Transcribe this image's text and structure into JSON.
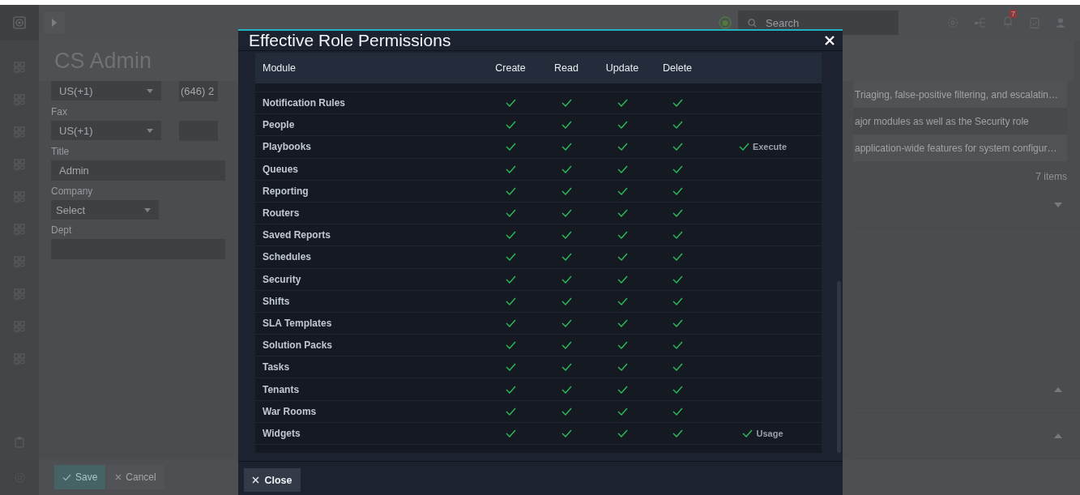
{
  "top_bar": {
    "search": {
      "placeholder": "Search"
    },
    "notification_count": "7"
  },
  "page": {
    "title": "CS Admin",
    "form": {
      "phone_country": "US(+1)",
      "phone_value": "(646) 2",
      "fax_label": "Fax",
      "fax_country": "US(+1)",
      "title_label": "Title",
      "title_value": "Admin",
      "company_label": "Company",
      "company_value": "Select",
      "dept_label": "Dept"
    },
    "role_descriptions": [
      "Triaging, false-positive filtering, and escalatin…",
      "ajor modules as well as the Security role",
      "application-wide features for system configur…"
    ],
    "items_count": "7 items",
    "footer": {
      "save": "Save",
      "cancel": "Cancel"
    }
  },
  "modal": {
    "title": "Effective Role Permissions",
    "columns": [
      "Module",
      "Create",
      "Read",
      "Update",
      "Delete"
    ],
    "rows": [
      {
        "module": "Notification Rules",
        "create": true,
        "read": true,
        "update": true,
        "delete": true
      },
      {
        "module": "People",
        "create": true,
        "read": true,
        "update": true,
        "delete": true
      },
      {
        "module": "Playbooks",
        "create": true,
        "read": true,
        "update": true,
        "delete": true,
        "extra": "Execute"
      },
      {
        "module": "Queues",
        "create": true,
        "read": true,
        "update": true,
        "delete": true
      },
      {
        "module": "Reporting",
        "create": true,
        "read": true,
        "update": true,
        "delete": true
      },
      {
        "module": "Routers",
        "create": true,
        "read": true,
        "update": true,
        "delete": true
      },
      {
        "module": "Saved Reports",
        "create": true,
        "read": true,
        "update": true,
        "delete": true
      },
      {
        "module": "Schedules",
        "create": true,
        "read": true,
        "update": true,
        "delete": true
      },
      {
        "module": "Security",
        "create": true,
        "read": true,
        "update": true,
        "delete": true
      },
      {
        "module": "Shifts",
        "create": true,
        "read": true,
        "update": true,
        "delete": true
      },
      {
        "module": "SLA Templates",
        "create": true,
        "read": true,
        "update": true,
        "delete": true
      },
      {
        "module": "Solution Packs",
        "create": true,
        "read": true,
        "update": true,
        "delete": true
      },
      {
        "module": "Tasks",
        "create": true,
        "read": true,
        "update": true,
        "delete": true
      },
      {
        "module": "Tenants",
        "create": true,
        "read": true,
        "update": true,
        "delete": true
      },
      {
        "module": "War Rooms",
        "create": true,
        "read": true,
        "update": true,
        "delete": true
      },
      {
        "module": "Widgets",
        "create": true,
        "read": true,
        "update": true,
        "delete": true,
        "extra": "Usage"
      }
    ],
    "close_label": "Close"
  }
}
